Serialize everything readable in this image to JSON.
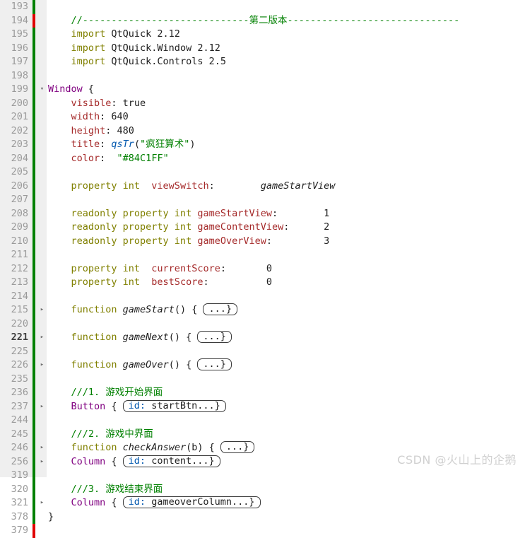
{
  "editor": {
    "gutter_bg": "#efefef",
    "background": "#ffffff",
    "marker_green": "#008000",
    "marker_red": "#e00000",
    "current_line": "221"
  },
  "watermark": {
    "text": "CSDN @火山上的企鹅"
  },
  "fold_icon_collapsed": "▸",
  "fold_icon_expanded": "▾",
  "lines": [
    {
      "no": "193",
      "mark": "green",
      "fold": "",
      "parts": []
    },
    {
      "no": "194",
      "mark": "red",
      "fold": "",
      "parts": [
        {
          "cls": "cmt2",
          "t": "    //-----------------------------第二版本------------------------------"
        }
      ]
    },
    {
      "no": "195",
      "mark": "green",
      "fold": "",
      "parts": [
        {
          "cls": "kw",
          "t": "    import "
        },
        {
          "cls": "num",
          "t": "QtQuick 2.12"
        }
      ]
    },
    {
      "no": "196",
      "mark": "green",
      "fold": "",
      "parts": [
        {
          "cls": "kw",
          "t": "    import "
        },
        {
          "cls": "num",
          "t": "QtQuick.Window 2.12"
        }
      ]
    },
    {
      "no": "197",
      "mark": "green",
      "fold": "",
      "parts": [
        {
          "cls": "kw",
          "t": "    import "
        },
        {
          "cls": "num",
          "t": "QtQuick.Controls 2.5"
        }
      ]
    },
    {
      "no": "198",
      "mark": "green",
      "fold": "",
      "parts": []
    },
    {
      "no": "199",
      "mark": "green",
      "fold": "expanded",
      "parts": [
        {
          "cls": "type",
          "t": "Window "
        },
        {
          "cls": "brace",
          "t": "{"
        }
      ]
    },
    {
      "no": "200",
      "mark": "green",
      "fold": "",
      "parts": [
        {
          "cls": "prop",
          "t": "    visible"
        },
        {
          "cls": "brace",
          "t": ": "
        },
        {
          "cls": "num",
          "t": "true"
        }
      ]
    },
    {
      "no": "201",
      "mark": "green",
      "fold": "",
      "parts": [
        {
          "cls": "prop",
          "t": "    width"
        },
        {
          "cls": "brace",
          "t": ": "
        },
        {
          "cls": "num",
          "t": "640"
        }
      ]
    },
    {
      "no": "202",
      "mark": "green",
      "fold": "",
      "parts": [
        {
          "cls": "prop",
          "t": "    height"
        },
        {
          "cls": "brace",
          "t": ": "
        },
        {
          "cls": "num",
          "t": "480"
        }
      ]
    },
    {
      "no": "203",
      "mark": "green",
      "fold": "",
      "parts": [
        {
          "cls": "prop",
          "t": "    title"
        },
        {
          "cls": "brace",
          "t": ": "
        },
        {
          "cls": "blu",
          "t": "qsTr"
        },
        {
          "cls": "brace",
          "t": "("
        },
        {
          "cls": "str",
          "t": "\"疯狂算术\""
        },
        {
          "cls": "brace",
          "t": ")"
        }
      ]
    },
    {
      "no": "204",
      "mark": "green",
      "fold": "",
      "parts": [
        {
          "cls": "prop",
          "t": "    color"
        },
        {
          "cls": "brace",
          "t": ":  "
        },
        {
          "cls": "str",
          "t": "\"#84C1FF\""
        }
      ]
    },
    {
      "no": "205",
      "mark": "green",
      "fold": "",
      "parts": []
    },
    {
      "no": "206",
      "mark": "green",
      "fold": "",
      "parts": [
        {
          "cls": "kw",
          "t": "    property int "
        },
        {
          "cls": "prop",
          "t": " viewSwitch"
        },
        {
          "cls": "brace",
          "t": ":        "
        },
        {
          "cls": "ital",
          "t": "gameStartView"
        }
      ]
    },
    {
      "no": "207",
      "mark": "green",
      "fold": "",
      "parts": []
    },
    {
      "no": "208",
      "mark": "green",
      "fold": "",
      "parts": [
        {
          "cls": "kw",
          "t": "    readonly property int "
        },
        {
          "cls": "prop",
          "t": "gameStartView"
        },
        {
          "cls": "brace",
          "t": ":        "
        },
        {
          "cls": "num",
          "t": "1"
        }
      ]
    },
    {
      "no": "209",
      "mark": "green",
      "fold": "",
      "parts": [
        {
          "cls": "kw",
          "t": "    readonly property int "
        },
        {
          "cls": "prop",
          "t": "gameContentView"
        },
        {
          "cls": "brace",
          "t": ":      "
        },
        {
          "cls": "num",
          "t": "2"
        }
      ]
    },
    {
      "no": "210",
      "mark": "green",
      "fold": "",
      "parts": [
        {
          "cls": "kw",
          "t": "    readonly property int "
        },
        {
          "cls": "prop",
          "t": "gameOverView"
        },
        {
          "cls": "brace",
          "t": ":         "
        },
        {
          "cls": "num",
          "t": "3"
        }
      ]
    },
    {
      "no": "211",
      "mark": "green",
      "fold": "",
      "parts": []
    },
    {
      "no": "212",
      "mark": "green",
      "fold": "",
      "parts": [
        {
          "cls": "kw",
          "t": "    property int "
        },
        {
          "cls": "prop",
          "t": " currentScore"
        },
        {
          "cls": "brace",
          "t": ":       "
        },
        {
          "cls": "num",
          "t": "0"
        }
      ]
    },
    {
      "no": "213",
      "mark": "green",
      "fold": "",
      "parts": [
        {
          "cls": "kw",
          "t": "    property int "
        },
        {
          "cls": "prop",
          "t": " bestScore"
        },
        {
          "cls": "brace",
          "t": ":          "
        },
        {
          "cls": "num",
          "t": "0"
        }
      ]
    },
    {
      "no": "214",
      "mark": "green",
      "fold": "",
      "parts": []
    },
    {
      "no": "215",
      "mark": "green",
      "fold": "collapsed",
      "parts": [
        {
          "cls": "kw",
          "t": "    function "
        },
        {
          "cls": "fn",
          "t": "gameStart"
        },
        {
          "cls": "brace",
          "t": "() { "
        },
        {
          "cls": "chip",
          "t": "...}"
        }
      ]
    },
    {
      "no": "220",
      "mark": "green",
      "fold": "",
      "parts": []
    },
    {
      "no": "221",
      "mark": "green",
      "fold": "collapsed",
      "cur": true,
      "parts": [
        {
          "cls": "kw",
          "t": "    function "
        },
        {
          "cls": "fn",
          "t": "gameNext"
        },
        {
          "cls": "brace",
          "t": "() { "
        },
        {
          "cls": "chip",
          "t": "...}"
        }
      ]
    },
    {
      "no": "225",
      "mark": "green",
      "fold": "",
      "parts": []
    },
    {
      "no": "226",
      "mark": "green",
      "fold": "collapsed",
      "parts": [
        {
          "cls": "kw",
          "t": "    function "
        },
        {
          "cls": "fn",
          "t": "gameOver"
        },
        {
          "cls": "brace",
          "t": "() { "
        },
        {
          "cls": "chip",
          "t": "...}"
        }
      ]
    },
    {
      "no": "235",
      "mark": "green",
      "fold": "",
      "parts": []
    },
    {
      "no": "236",
      "mark": "green",
      "fold": "",
      "parts": [
        {
          "cls": "cmt2",
          "t": "    ///1. 游戏开始界面"
        }
      ]
    },
    {
      "no": "237",
      "mark": "green",
      "fold": "collapsed",
      "parts": [
        {
          "cls": "type",
          "t": "    Button "
        },
        {
          "cls": "brace",
          "t": "{ "
        },
        {
          "cls": "chip-id",
          "t": "id: startBtn...}"
        }
      ]
    },
    {
      "no": "244",
      "mark": "green",
      "fold": "",
      "parts": []
    },
    {
      "no": "245",
      "mark": "green",
      "fold": "",
      "parts": [
        {
          "cls": "cmt2",
          "t": "    ///2. 游戏中界面"
        }
      ]
    },
    {
      "no": "246",
      "mark": "green",
      "fold": "collapsed",
      "parts": [
        {
          "cls": "kw",
          "t": "    function "
        },
        {
          "cls": "fn",
          "t": "checkAnswer"
        },
        {
          "cls": "brace",
          "t": "(b) { "
        },
        {
          "cls": "chip",
          "t": "...}"
        }
      ]
    },
    {
      "no": "256",
      "mark": "green",
      "fold": "collapsed",
      "parts": [
        {
          "cls": "type",
          "t": "    Column "
        },
        {
          "cls": "brace",
          "t": "{ "
        },
        {
          "cls": "chip-id",
          "t": "id: content...}"
        }
      ]
    },
    {
      "no": "319",
      "mark": "green",
      "fold": "",
      "parts": []
    },
    {
      "no": "320",
      "mark": "green",
      "fold": "",
      "parts": [
        {
          "cls": "cmt2",
          "t": "    ///3. 游戏结束界面"
        }
      ]
    },
    {
      "no": "321",
      "mark": "green",
      "fold": "collapsed",
      "parts": [
        {
          "cls": "type",
          "t": "    Column "
        },
        {
          "cls": "brace",
          "t": "{ "
        },
        {
          "cls": "chip-id",
          "t": "id: gameoverColumn...}"
        }
      ]
    },
    {
      "no": "378",
      "mark": "green",
      "fold": "",
      "parts": [
        {
          "cls": "brace",
          "t": "}"
        }
      ]
    },
    {
      "no": "379",
      "mark": "red",
      "fold": "",
      "parts": []
    }
  ]
}
